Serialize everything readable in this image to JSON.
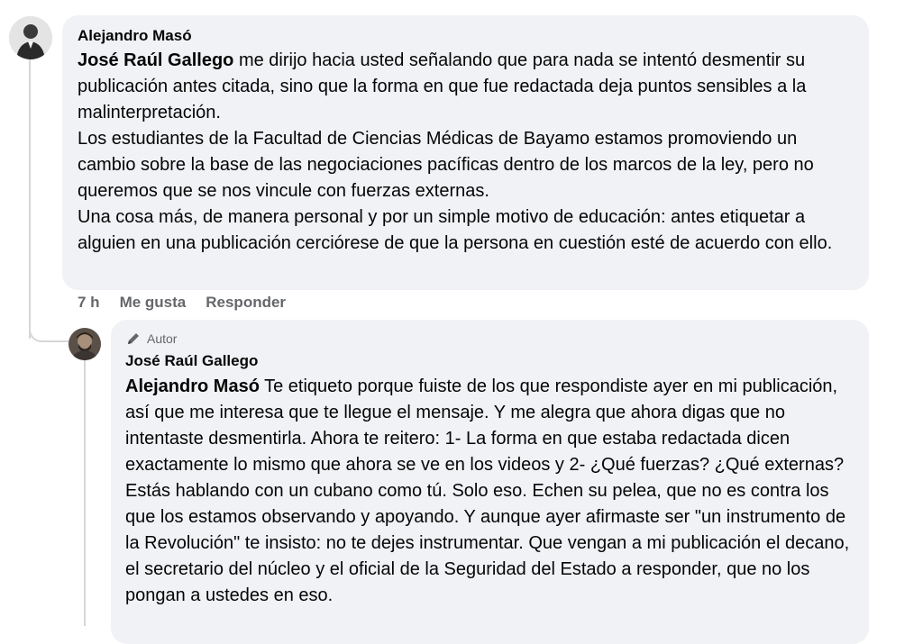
{
  "comment1": {
    "author": "Alejandro Masó",
    "mention": "José Raúl Gallego",
    "text_after_mention": " me dirijo hacia usted señalando que para nada se intentó desmentir su publicación antes citada, sino que la forma en que fue redactada deja puntos sensibles a la malinterpretación.",
    "paragraphs": [
      "Los estudiantes de la Facultad de Ciencias Médicas de Bayamo estamos promoviendo un cambio sobre la base de las negociaciones pacíficas dentro de los marcos de la ley, pero no queremos que se nos vincule con fuerzas externas.",
      "Una cosa más, de manera personal y por un simple motivo de educación: antes etiquetar a alguien en una publicación cerciórese de que la persona en cuestión esté de acuerdo con ello."
    ],
    "time": "7 h",
    "like_label": "Me gusta",
    "reply_label": "Responder"
  },
  "comment2": {
    "badge_label": "Autor",
    "badge_icon": "pencil-icon",
    "author": "José Raúl Gallego",
    "mention": "Alejandro Masó",
    "text_after_mention": " Te etiqueto porque fuiste de los que respondiste ayer en mi publicación, así que me interesa que te llegue el mensaje. Y me alegra que ahora digas que no intentaste desmentirla. Ahora te reitero: 1- La forma en que estaba redactada dicen exactamente lo mismo que ahora se ve en los videos y 2- ¿Qué fuerzas? ¿Qué externas? Estás hablando con un cubano como tú. Solo eso. Echen su pelea, que no es contra los que los estamos observando y apoyando. Y aunque ayer afirmaste ser \"un instrumento de la Revolución\" te insisto: no te dejes instrumentar. Que vengan a mi publicación el decano, el secretario del núcleo y el oficial de la Seguridad del Estado a responder, que no los pongan a ustedes en eso."
  },
  "colors": {
    "bubble_bg": "#f0f2f5",
    "meta_text": "#65676b",
    "thread_line": "#d5d7da"
  }
}
